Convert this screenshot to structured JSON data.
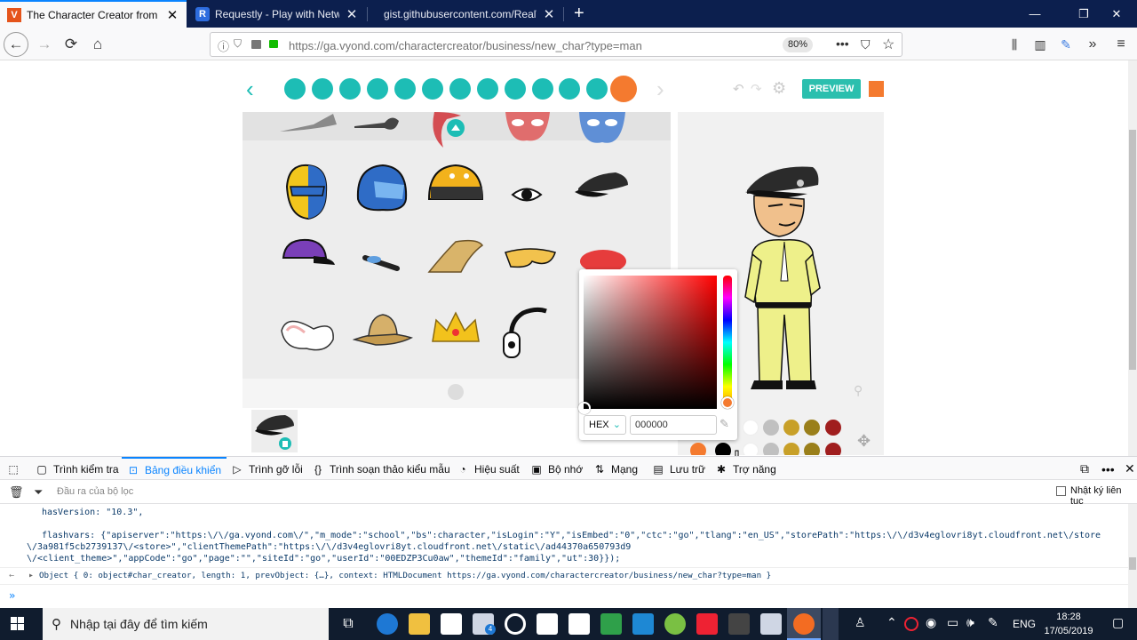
{
  "browser": {
    "tabs": [
      {
        "favicon": "V",
        "title": "The Character Creator from Vy"
      },
      {
        "favicon": "R",
        "title": "Requestly - Play with Network"
      },
      {
        "favicon": "",
        "title": "gist.githubusercontent.com/RealW"
      }
    ],
    "new_tab_icon": "plus-icon",
    "url": "https://ga.vyond.com/charactercreator/business/new_char?type=man",
    "zoom": "80%",
    "colors": {
      "tab_bar": "#0c1f4e",
      "accent": "#0a84ff"
    }
  },
  "app": {
    "preview_label": "PREVIEW",
    "accent_teal": "#1dbdb5",
    "accent_orange": "#f47a2f",
    "color_picker": {
      "mode": "HEX",
      "value": "000000",
      "swatches_row1": [
        "#ffffff",
        "#c0c0c0",
        "#c8a028",
        "#9a7f1a",
        "#a01e1e"
      ],
      "swatches_row2": [
        "#f47a2f",
        "#000000",
        "#ffffff",
        "#c0c0c0",
        "#c8a028",
        "#9a7f1a",
        "#a01e1e"
      ]
    }
  },
  "devtools": {
    "tabs": [
      "Trình kiểm tra",
      "Bảng điều khiển",
      "Trình gỡ lỗi",
      "Trình soạn thảo kiểu mẫu",
      "Hiệu suất",
      "Bộ nhớ",
      "Mạng",
      "Lưu trữ",
      "Trợ năng"
    ],
    "active_tab": "Bảng điều khiển",
    "filter_placeholder": "Đầu ra của bộ lọc",
    "persist_logs_label": "Nhật ký liên tục",
    "console_lines": [
      "hasVersion: \"10.3\",",
      "flashvars: {\"apiserver\":\"https:\\/\\/ga.vyond.com\\/\",\"m_mode\":\"school\",\"bs\":character,\"isLogin\":\"Y\",\"isEmbed\":\"0\",\"ctc\":\"go\",\"tlang\":\"en_US\",\"storePath\":\"https:\\/\\/d3v4eglovri8yt.cloudfront.net\\/store",
      "\\/3a981f5cb2739137\\/<store>\",\"clientThemePath\":\"https:\\/\\/d3v4eglovri8yt.cloudfront.net\\/static\\/ad44370a650793d9",
      "\\/<client_theme>\",\"appCode\":\"go\",\"page\":\"\",\"siteId\":\"go\",\"userId\":\"00EDZP3Cu0aw\",\"themeId\":\"family\",\"ut\":30}});",
      "Object { 0: object#char_creator, length: 1, prevObject: {…}, context: HTMLDocument https://ga.vyond.com/charactercreator/business/new_char?type=man }"
    ],
    "prompt": "»"
  },
  "taskbar": {
    "search_placeholder": "Nhập tại đây để tìm kiếm",
    "language": "ENG",
    "time": "18:28",
    "date": "17/05/2019",
    "mail_badge": "4"
  }
}
